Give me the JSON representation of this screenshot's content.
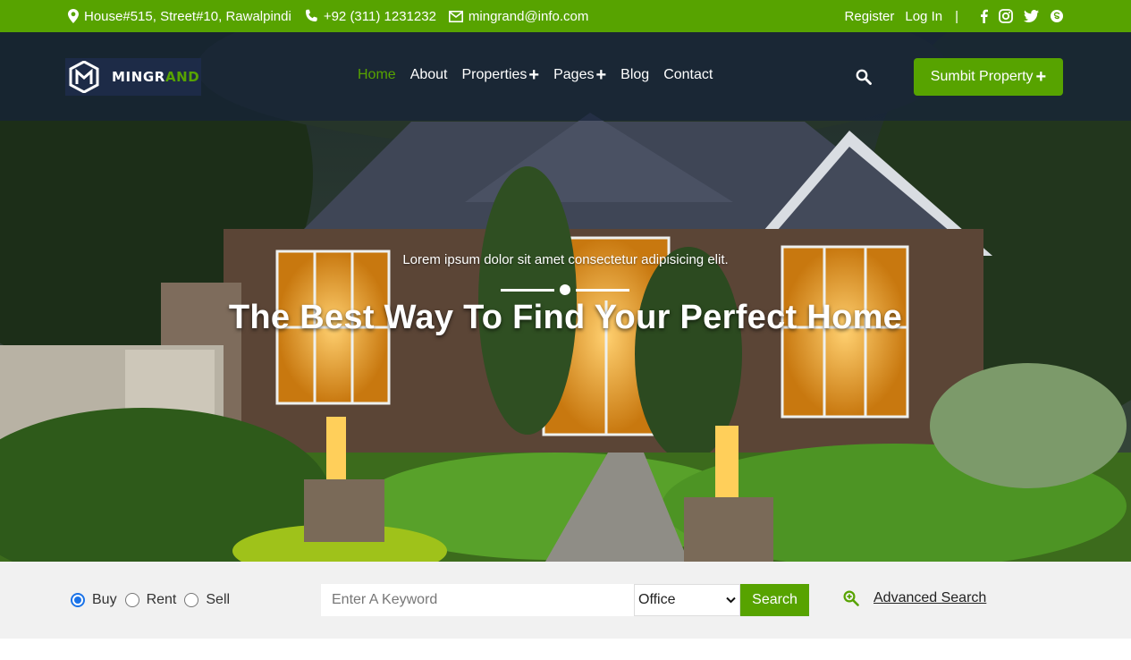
{
  "topbar": {
    "address": "House#515, Street#10, Rawalpindi",
    "phone": "+92 (311) 1231232",
    "email": "mingrand@info.com",
    "register": "Register",
    "login": "Log In",
    "separator": "|",
    "background": "#57a300"
  },
  "brand": {
    "name_part1": "MINGR",
    "name_part2": "AND",
    "accent_color": "#57a300"
  },
  "nav": {
    "items": [
      {
        "label": "Home",
        "active": true
      },
      {
        "label": "About",
        "active": false
      },
      {
        "label": "Properties",
        "active": false,
        "dropdown": true
      },
      {
        "label": "Pages",
        "active": false,
        "dropdown": true
      },
      {
        "label": "Blog",
        "active": false
      },
      {
        "label": "Contact",
        "active": false
      }
    ],
    "submit_label": "Sumbit Property",
    "plus": "+"
  },
  "hero": {
    "subtitle": "Lorem ipsum dolor sit amet consectetur adipisicing elit.",
    "title": "The Best Way To Find Your Perfect Home"
  },
  "search": {
    "options": [
      {
        "label": "Buy",
        "checked": true
      },
      {
        "label": "Rent",
        "checked": false
      },
      {
        "label": "Sell",
        "checked": false
      }
    ],
    "keyword_placeholder": "Enter A Keyword",
    "type_selected": "Office",
    "button_label": "Search",
    "advanced_label": "Advanced Search"
  },
  "icons": {
    "address": "map-pin-icon",
    "phone": "phone-icon",
    "email": "envelope-icon",
    "social": [
      "facebook-icon",
      "instagram-icon",
      "twitter-icon",
      "skype-icon"
    ],
    "search": "search-icon",
    "advanced": "zoom-in-icon"
  }
}
